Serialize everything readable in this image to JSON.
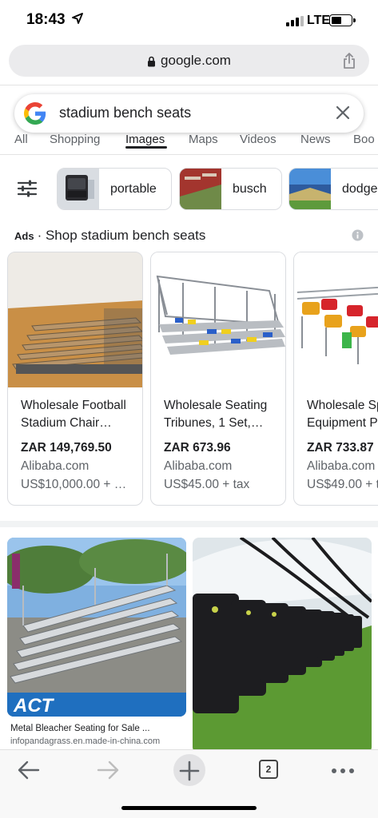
{
  "status_bar": {
    "time": "18:43",
    "network": "LTE"
  },
  "browser": {
    "url": "google.com"
  },
  "search": {
    "query": "stadium bench seats"
  },
  "tabs": [
    {
      "label": "All"
    },
    {
      "label": "Shopping"
    },
    {
      "label": "Images"
    },
    {
      "label": "Maps"
    },
    {
      "label": "Videos"
    },
    {
      "label": "News"
    },
    {
      "label": "Boo"
    }
  ],
  "chips": [
    {
      "label": "portable"
    },
    {
      "label": "busch"
    },
    {
      "label": "dodge"
    }
  ],
  "ads": {
    "label": "Ads",
    "separator": "·",
    "title": "Shop stadium bench seats",
    "products": [
      {
        "title": "Wholesale Football Stadium Chair…",
        "price": "ZAR 149,769.50",
        "store": "Alibaba.com",
        "shipping": "US$10,000.00 + …"
      },
      {
        "title": "Wholesale Seating Tribunes, 1 Set,…",
        "price": "ZAR 673.96",
        "store": "Alibaba.com",
        "shipping": "US$45.00 + tax"
      },
      {
        "title": "Wholesale Sp… Equipment P…",
        "price": "ZAR 733.87",
        "store": "Alibaba.com",
        "shipping": "US$49.00 + t"
      }
    ]
  },
  "results": [
    {
      "title": "Metal Bleacher Seating for Sale ...",
      "source": "infopandagrass.en.made-in-china.com",
      "image_text": "ACT"
    },
    {
      "title": "",
      "source": ""
    }
  ],
  "toolbar": {
    "tab_count": "2"
  },
  "colors": {
    "google_blue": "#4285F4",
    "google_red": "#EA4335",
    "google_yellow": "#FBBC05",
    "google_green": "#34A853",
    "text_secondary": "#5f6368"
  }
}
